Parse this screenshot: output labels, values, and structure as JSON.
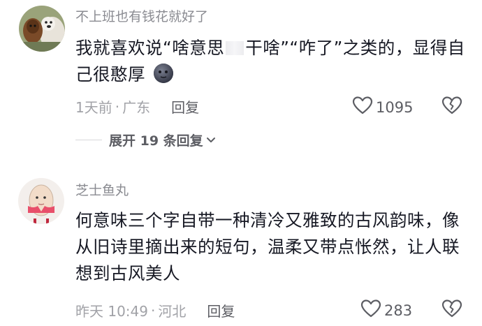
{
  "comments": [
    {
      "username": "不上班也有钱花就好了",
      "text_part1": "我就喜欢说“啥意思",
      "text_part2": "干啥”“咋了”之类的，显得自己很憨厚",
      "time": "1天前",
      "separator": "·",
      "location": "广东",
      "reply_label": "回复",
      "likes": "1095",
      "emoji": "moon-face-emoji"
    },
    {
      "username": "芝士鱼丸",
      "text": "何意味三个字自带一种清冷又雅致的古风韵味，像从旧诗里摘出来的短句，温柔又带点怅然，让人联想到古风美人",
      "time": "昨天 10:49",
      "separator": "·",
      "location": "河北",
      "reply_label": "回复",
      "likes": "283"
    }
  ],
  "expand_replies": {
    "label": "展开 19 条回复",
    "icon": "chevron-down-icon"
  },
  "colors": {
    "text": "#161823",
    "muted": "#8a8b91",
    "secondary": "#5c5d63"
  }
}
